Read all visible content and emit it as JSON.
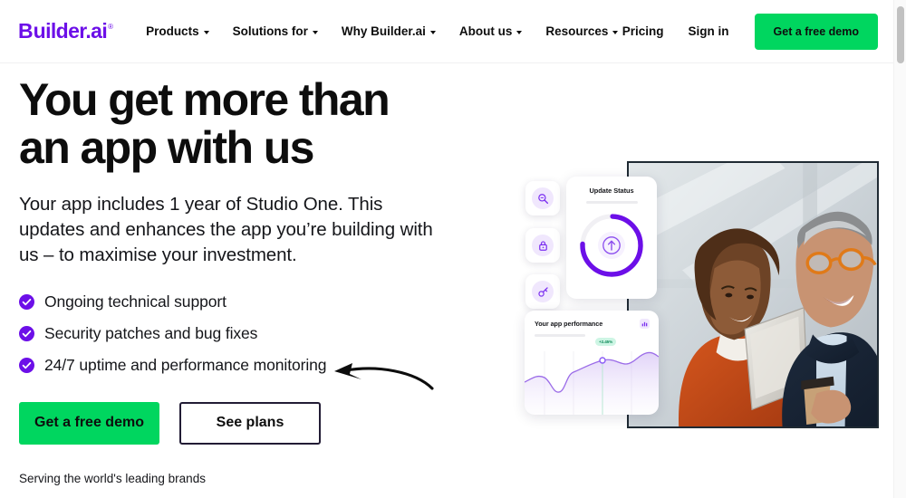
{
  "brand": {
    "name": "Builder.ai",
    "logo_first_letter": "B",
    "logo_rest": "uilder.ai",
    "registered_mark": "®",
    "purple": "#6C0FE8",
    "green": "#00D65F",
    "ink": "#0D0D0D"
  },
  "header": {
    "nav": [
      {
        "label": "Products",
        "has_caret": true,
        "icon": "chevron-down-icon"
      },
      {
        "label": "Solutions for",
        "has_caret": true,
        "icon": "chevron-down-icon"
      },
      {
        "label": "Why Builder.ai",
        "has_caret": true,
        "icon": "chevron-down-icon"
      },
      {
        "label": "About us",
        "has_caret": true,
        "icon": "chevron-down-icon"
      },
      {
        "label": "Resources",
        "has_caret": true,
        "icon": "chevron-down-icon"
      }
    ],
    "pricing_label": "Pricing",
    "signin_label": "Sign in",
    "demo_button_label": "Get a free demo"
  },
  "hero": {
    "headline": "You get more than an app with us",
    "subhead": "Your app includes 1 year of Studio One. This updates and enhances the app you’re building with us – to maximise your investment.",
    "bullets": [
      {
        "label": "Ongoing technical support",
        "icon": "check-circle-icon"
      },
      {
        "label": "Security patches and bug fixes",
        "icon": "check-circle-icon"
      },
      {
        "label": "24/7 uptime and performance monitoring",
        "icon": "check-circle-icon"
      }
    ],
    "primary_cta": "Get a free demo",
    "secondary_cta": "See plans",
    "annotation_icon": "curved-arrow-icon",
    "serving_text": "Serving the world's leading brands"
  },
  "visual": {
    "photo_alt": "Two colleagues smiling while looking at a tablet",
    "icon_cards": [
      {
        "icon": "magnifier-icon"
      },
      {
        "icon": "lock-icon"
      },
      {
        "icon": "key-icon"
      }
    ],
    "status_card": {
      "title": "Update Status",
      "progress_percent": 75,
      "center_icon": "arrow-up-circle-icon",
      "ring_color": "#6C0FE8",
      "track_color": "#F1F0F4"
    },
    "performance_card": {
      "title": "Your app performance",
      "header_icon": "bar-chart-icon",
      "badge_label": "+2.45%",
      "badge_bg": "#CDF5E4",
      "badge_text_color": "#0F8A5A",
      "line_color": "#9B6CE8"
    }
  },
  "chart_data": {
    "type": "area",
    "title": "Your app performance",
    "xlabel": "",
    "ylabel": "",
    "grid": true,
    "legend": "none",
    "ylim": [
      0,
      100
    ],
    "x": [
      0,
      1,
      2,
      3,
      4,
      5,
      6,
      7,
      8,
      9,
      10,
      11,
      12
    ],
    "values": [
      48,
      52,
      41,
      30,
      33,
      58,
      64,
      70,
      76,
      72,
      68,
      70,
      82
    ],
    "annotations": [
      {
        "x": 8,
        "y": 76,
        "label": "+2.45%",
        "marker": "circle"
      }
    ]
  },
  "scrollbar": {
    "thumb_position": "top"
  }
}
